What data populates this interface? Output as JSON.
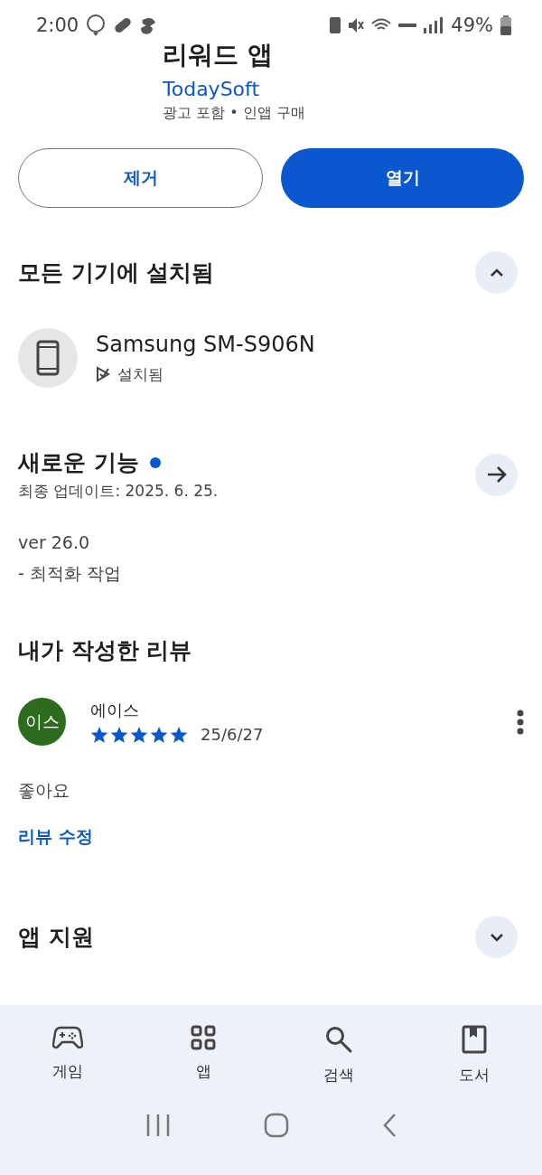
{
  "status_bar": {
    "time": "2:00",
    "battery": "49%"
  },
  "app": {
    "title": "리워드 앱",
    "developer": "TodaySoft",
    "notes": "광고 포함 • 인앱 구매"
  },
  "buttons": [
    {
      "label": "제거",
      "kind": "outline"
    },
    {
      "label": "열기",
      "kind": "filled"
    }
  ],
  "installed_section": {
    "title": "모든 기기에 설치됨",
    "expanded": true,
    "device": {
      "name": "Samsung SM-S906N",
      "status": "설치됨"
    }
  },
  "whats_new": {
    "title": "새로운 기능",
    "new_dot": true,
    "updated": "최종 업데이트: 2025. 6. 25.",
    "lines": [
      "ver 26.0",
      "- 최적화 작업"
    ]
  },
  "my_review": {
    "title": "내가 작성한 리뷰",
    "avatar": "이스",
    "author": "에이스",
    "stars": 5,
    "date": "25/6/27",
    "text": "좋아요",
    "edit_link": "리뷰 수정"
  },
  "app_support": {
    "title": "앱 지원",
    "expanded": false
  },
  "bottom_nav": [
    {
      "label": "게임",
      "kind": "games"
    },
    {
      "label": "앱",
      "kind": "apps"
    },
    {
      "label": "검색",
      "kind": "search"
    },
    {
      "label": "도서",
      "kind": "books"
    }
  ]
}
